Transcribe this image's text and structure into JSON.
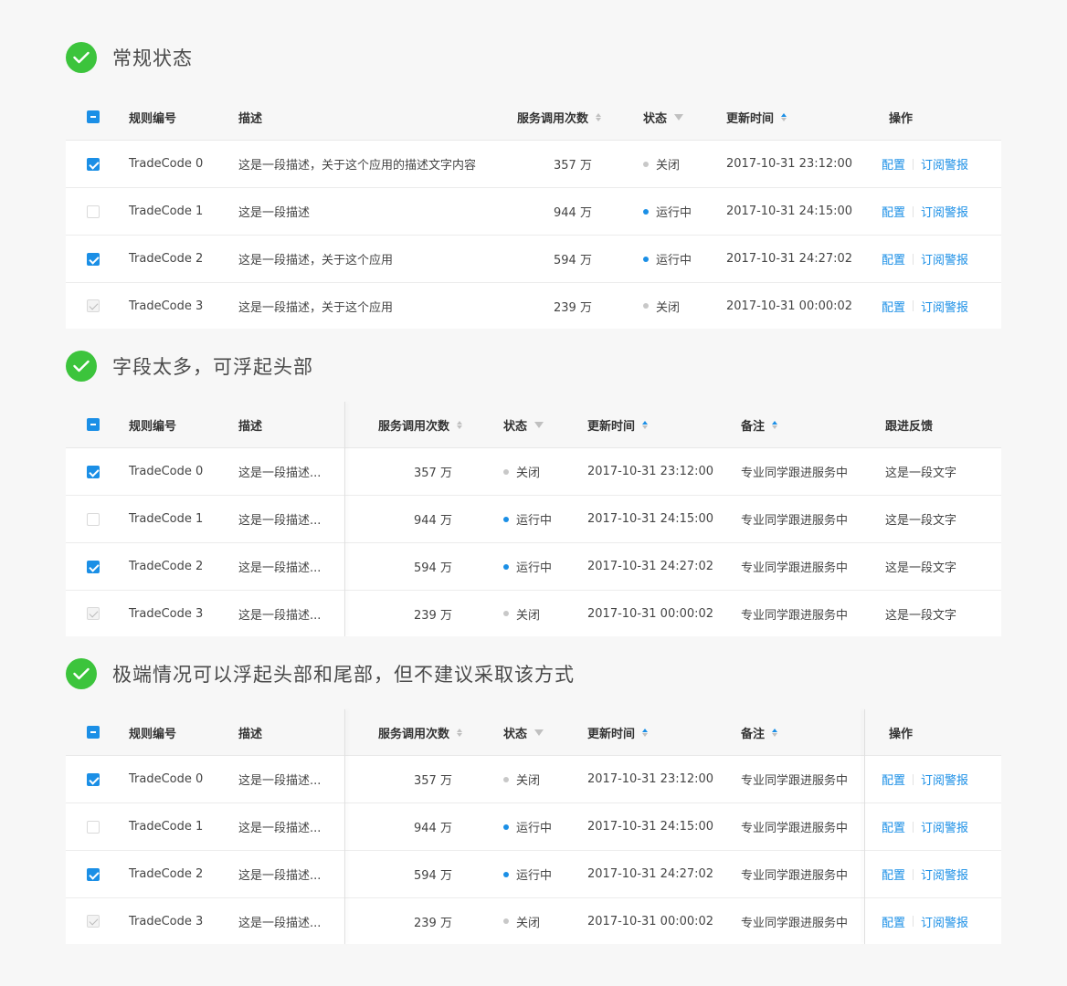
{
  "colors": {
    "accent": "#1b8fe6",
    "success": "#3cc43c"
  },
  "sections": [
    {
      "title": "常规状态",
      "headers": {
        "id": "规则编号",
        "desc": "描述",
        "calls": "服务调用次数",
        "status": "状态",
        "time": "更新时间",
        "ops": "操作"
      },
      "rows": [
        {
          "id": "TradeCode 0",
          "desc": "这是一段描述，关于这个应用的描述文字内容",
          "calls": "357 万",
          "status": "关闭",
          "time": "2017-10-31  23:12:00",
          "op1": "配置",
          "op2": "订阅警报"
        },
        {
          "id": "TradeCode 1",
          "desc": "这是一段描述",
          "calls": "944 万",
          "status": "运行中",
          "time": "2017-10-31  24:15:00",
          "op1": "配置",
          "op2": "订阅警报"
        },
        {
          "id": "TradeCode 2",
          "desc": "这是一段描述，关于这个应用",
          "calls": "594 万",
          "status": "运行中",
          "time": "2017-10-31  24:27:02",
          "op1": "配置",
          "op2": "订阅警报"
        },
        {
          "id": "TradeCode 3",
          "desc": "这是一段描述，关于这个应用",
          "calls": "239 万",
          "status": "关闭",
          "time": "2017-10-31  00:00:02",
          "op1": "配置",
          "op2": "订阅警报"
        }
      ]
    },
    {
      "title": "字段太多，可浮起头部",
      "headers": {
        "id": "规则编号",
        "desc": "描述",
        "calls": "服务调用次数",
        "status": "状态",
        "time": "更新时间",
        "note": "备注",
        "follow": "跟进反馈"
      },
      "rows": [
        {
          "id": "TradeCode 0",
          "desc": "这是一段描述...",
          "calls": "357 万",
          "status": "关闭",
          "time": "2017-10-31  23:12:00",
          "note": "专业同学跟进服务中",
          "follow": "这是一段文字"
        },
        {
          "id": "TradeCode 1",
          "desc": "这是一段描述...",
          "calls": "944 万",
          "status": "运行中",
          "time": "2017-10-31  24:15:00",
          "note": "专业同学跟进服务中",
          "follow": "这是一段文字"
        },
        {
          "id": "TradeCode 2",
          "desc": "这是一段描述...",
          "calls": "594 万",
          "status": "运行中",
          "time": "2017-10-31  24:27:02",
          "note": "专业同学跟进服务中",
          "follow": "这是一段文字"
        },
        {
          "id": "TradeCode 3",
          "desc": "这是一段描述...",
          "calls": "239 万",
          "status": "关闭",
          "time": "2017-10-31  00:00:02",
          "note": "专业同学跟进服务中",
          "follow": "这是一段文字"
        }
      ]
    },
    {
      "title": "极端情况可以浮起头部和尾部，但不建议采取该方式",
      "headers": {
        "id": "规则编号",
        "desc": "描述",
        "calls": "服务调用次数",
        "status": "状态",
        "time": "更新时间",
        "note": "备注",
        "ops": "操作"
      },
      "rows": [
        {
          "id": "TradeCode 0",
          "desc": "这是一段描述...",
          "calls": "357 万",
          "status": "关闭",
          "time": "2017-10-31  23:12:00",
          "note": "专业同学跟进服务中",
          "op1": "配置",
          "op2": "订阅警报"
        },
        {
          "id": "TradeCode 1",
          "desc": "这是一段描述...",
          "calls": "944 万",
          "status": "运行中",
          "time": "2017-10-31  24:15:00",
          "note": "专业同学跟进服务中",
          "op1": "配置",
          "op2": "订阅警报"
        },
        {
          "id": "TradeCode 2",
          "desc": "这是一段描述...",
          "calls": "594 万",
          "status": "运行中",
          "time": "2017-10-31  24:27:02",
          "note": "专业同学跟进服务中",
          "op1": "配置",
          "op2": "订阅警报"
        },
        {
          "id": "TradeCode 3",
          "desc": "这是一段描述...",
          "calls": "239 万",
          "status": "关闭",
          "time": "2017-10-31  00:00:02",
          "note": "专业同学跟进服务中",
          "op1": "配置",
          "op2": "订阅警报"
        }
      ]
    }
  ]
}
